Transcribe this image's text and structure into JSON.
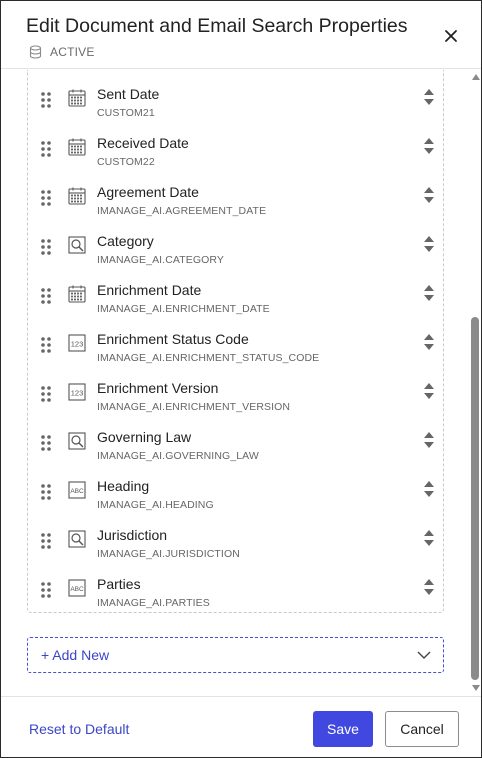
{
  "dialog": {
    "title": "Edit Document and Email Search Properties",
    "status": "ACTIVE"
  },
  "fields": [
    {
      "label": "Sent Date",
      "key": "CUSTOM21",
      "type": "calendar-icon"
    },
    {
      "label": "Received Date",
      "key": "CUSTOM22",
      "type": "calendar-icon"
    },
    {
      "label": "Agreement Date",
      "key": "IMANAGE_AI.AGREEMENT_DATE",
      "type": "calendar-icon"
    },
    {
      "label": "Category",
      "key": "IMANAGE_AI.CATEGORY",
      "type": "lookup-icon"
    },
    {
      "label": "Enrichment Date",
      "key": "IMANAGE_AI.ENRICHMENT_DATE",
      "type": "calendar-icon"
    },
    {
      "label": "Enrichment Status Code",
      "key": "IMANAGE_AI.ENRICHMENT_STATUS_CODE",
      "type": "number-icon"
    },
    {
      "label": "Enrichment Version",
      "key": "IMANAGE_AI.ENRICHMENT_VERSION",
      "type": "number-icon"
    },
    {
      "label": "Governing Law",
      "key": "IMANAGE_AI.GOVERNING_LAW",
      "type": "lookup-icon"
    },
    {
      "label": "Heading",
      "key": "IMANAGE_AI.HEADING",
      "type": "text-icon"
    },
    {
      "label": "Jurisdiction",
      "key": "IMANAGE_AI.JURISDICTION",
      "type": "lookup-icon"
    },
    {
      "label": "Parties",
      "key": "IMANAGE_AI.PARTIES",
      "type": "text-icon"
    }
  ],
  "add_new": {
    "label": "+ Add New"
  },
  "footer": {
    "reset_label": "Reset to Default",
    "save_label": "Save",
    "cancel_label": "Cancel"
  },
  "colors": {
    "accent": "#4048e0",
    "link": "#3b46c8"
  }
}
